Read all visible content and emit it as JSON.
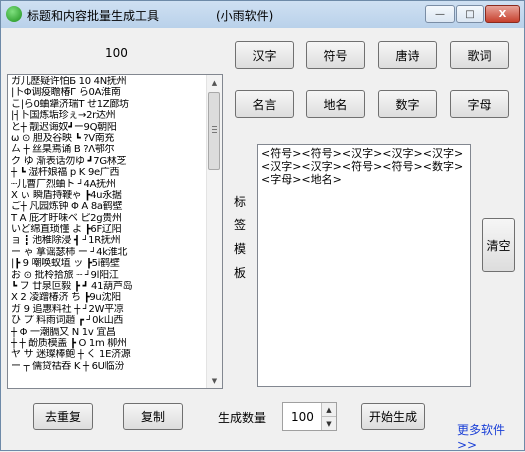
{
  "window": {
    "title": "标题和内容批量生成工具",
    "title_extra": "(小雨软件)",
    "minimize_glyph": "—",
    "maximize_glyph": "□",
    "close_glyph": "X"
  },
  "list": {
    "count_label": "100",
    "lines": [
      "ガ儿歷疑许怕Б 10 4N抚州",
      "|卜Φ调疫瞻椿Г ら0A淮南",
      "こ|ら0蛐犟济瑞Т せ1Z廊坊",
      "|┤卜国炼垢珍ぇ→2r达州",
      "と┼ 靓迟诲奴┛ー9Q朝阳",
      "ω ⊙ 胆及谷映 ┗ ?V南充",
      "ㄙ ┼ 丝臬焉诵 В ?Λ鄂尔",
      "ク ゆ 渐表话勿ゆ ┛7G林芝",
      "┼ ┗ 湿杆娘福 p K 9e广西",
      "┈儿曹厂烈蛐ト ┘4A抚州",
      "X ぃ 瞬盾持鞭ゃ ┣4u永据",
      "ご┼ 凡园炼钟 Φ A 8a鹤壁",
      "T A 庇才盱味ベ ピ2g贵州",
      "いど绵直琐懂 よ ┣6F辽阳",
      "ョ ┇ 池稚除浸 ┫ ┘1R抚州",
      "ー ゃ 拿谣瑟柿 ー ┘4k淮北",
      "|┣ 9 嘲唤蚁埴 ッ ┣5i鹤壁",
      "お ⊙ 批柃拾旅 ┈ ┘9l阳江",
      "┗ フ 廿泉叵毅 ┣ ┛ 41葫芦岛",
      "X 2 凌蹭椿济 ち ┣9u沈阳",
      "ガ 9 追惠料社 ┼ ┘2W平凉",
      "ひ プ 料雨词趙 ┏ ┘0k山西",
      "┼ Φ 一潮膈又 Ν 1v 宜昌",
      "┼ ┼ 酚质模盖 ┣ Ο 1m 柳州",
      "ヤ サ 迷璨棒鲍 ┼ く 1E济源",
      "ー ┬ 儒贷祜吞 K ┼ 6U临汾"
    ]
  },
  "category_buttons": [
    "汉字",
    "符号",
    "唐诗",
    "歌词",
    "名言",
    "地名",
    "数字",
    "字母"
  ],
  "tag_template": {
    "side_label_chars": [
      "标",
      "签",
      "模",
      "板"
    ],
    "content": "<符号><符号><汉字><汉字><汉字><汉字><汉字><符号><符号><数字><字母><地名>"
  },
  "clear_button": "清空",
  "bottom": {
    "dedupe_button": "去重复",
    "copy_button": "复制",
    "gen_count_label": "生成数量",
    "gen_count_value": "100",
    "start_button": "开始生成",
    "more_link": "更多软件>>"
  }
}
